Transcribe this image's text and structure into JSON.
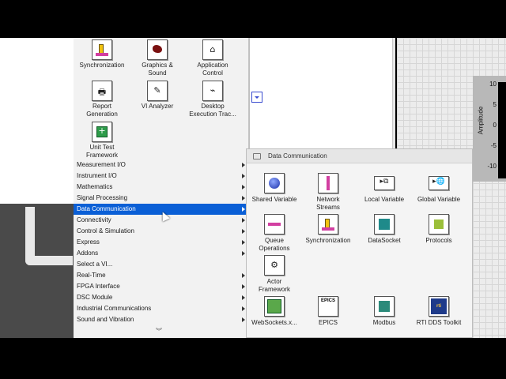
{
  "top_tiles": [
    {
      "label": "Synchronization",
      "icon": "synchronization-icon"
    },
    {
      "label": "Graphics &\nSound",
      "icon": "graphics-sound-icon"
    },
    {
      "label": "Application\nControl",
      "icon": "application-control-icon"
    },
    {
      "label": "Report\nGeneration",
      "icon": "report-generation-icon"
    },
    {
      "label": "VI Analyzer",
      "icon": "vi-analyzer-icon"
    },
    {
      "label": "Desktop\nExecution Trac...",
      "icon": "desktop-execution-trace-icon"
    },
    {
      "label": "Unit Test\nFramework",
      "icon": "unit-test-framework-icon"
    }
  ],
  "categories": [
    {
      "label": "Measurement I/O",
      "has_sub": true
    },
    {
      "label": "Instrument I/O",
      "has_sub": true
    },
    {
      "label": "Mathematics",
      "has_sub": true
    },
    {
      "label": "Signal Processing",
      "has_sub": true
    },
    {
      "label": "Data Communication",
      "has_sub": true,
      "selected": true
    },
    {
      "label": "Connectivity",
      "has_sub": true
    },
    {
      "label": "Control & Simulation",
      "has_sub": true
    },
    {
      "label": "Express",
      "has_sub": true
    },
    {
      "label": "Addons",
      "has_sub": true
    },
    {
      "label": "Select a VI...",
      "has_sub": false
    },
    {
      "label": "Real-Time",
      "has_sub": true
    },
    {
      "label": "FPGA Interface",
      "has_sub": true
    },
    {
      "label": "DSC Module",
      "has_sub": true
    },
    {
      "label": "Industrial Communications",
      "has_sub": true
    },
    {
      "label": "Sound and Vibration",
      "has_sub": true
    }
  ],
  "scroll_more": "︾",
  "sub_palette": {
    "title": "Data Communication",
    "items": [
      {
        "label": "Shared Variable",
        "icon": "shared-variable-icon"
      },
      {
        "label": "Network\nStreams",
        "icon": "network-streams-icon"
      },
      {
        "label": "Local Variable",
        "icon": "local-variable-icon",
        "glyph": "▸⧉"
      },
      {
        "label": "Global Variable",
        "icon": "global-variable-icon",
        "glyph": "▸🌐"
      },
      {
        "label": "Queue\nOperations",
        "icon": "queue-operations-icon"
      },
      {
        "label": "Synchronization",
        "icon": "synchronization-icon"
      },
      {
        "label": "DataSocket",
        "icon": "datasocket-icon"
      },
      {
        "label": "Protocols",
        "icon": "protocols-icon"
      },
      {
        "label": "Actor\nFramework",
        "icon": "actor-framework-icon",
        "glyph": "⚙"
      },
      {
        "label": "WebSockets.x...",
        "icon": "websockets-icon"
      },
      {
        "label": "EPICS",
        "icon": "epics-icon",
        "glyph": "EPICS"
      },
      {
        "label": "Modbus",
        "icon": "modbus-icon"
      },
      {
        "label": "RTI DDS Toolkit",
        "icon": "rti-dds-toolkit-icon",
        "glyph": "rti"
      }
    ]
  },
  "chart": {
    "ylabel": "Amplitude",
    "ticks": [
      "10",
      "5",
      "0",
      "-5",
      "-10"
    ]
  }
}
